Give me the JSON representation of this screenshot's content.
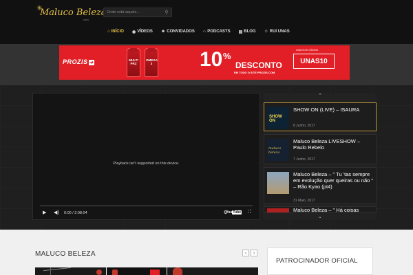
{
  "header": {
    "logo_text": "Maluco Beleza",
    "logo_sub": ".com",
    "search_placeholder": "Onde está aquele...",
    "nav": [
      {
        "label": "INÍCIO",
        "icon": "home-icon"
      },
      {
        "label": "VÍDEOS",
        "icon": "play-circle-icon"
      },
      {
        "label": "CONVIDADOS",
        "icon": "users-icon"
      },
      {
        "label": "PODCASTS",
        "icon": "headphones-icon"
      },
      {
        "label": "BLOG",
        "icon": "blog-icon"
      },
      {
        "label": "RUI UNAS",
        "icon": "user-icon"
      }
    ]
  },
  "banner": {
    "brand": "PROZIS",
    "bottle1": "MULTI PRZ",
    "bottle2": "OMEGA 3",
    "percent": "10",
    "percent_sign": "%",
    "discount": "DESCONTO",
    "subtext": "EM TODO O SITE PROZIS.COM",
    "code_label": "USA ESTE CÓDIGO",
    "code": "UNAS10"
  },
  "player": {
    "message": "Playback isn't supported on this device.",
    "time": "0:00  /  2:08:04",
    "yt_label": "You",
    "yt_tube": "Tube"
  },
  "playlist": [
    {
      "title": "SHOW ON (LIVE) – ISAURA",
      "date": "8 Junho, 2017",
      "thumb": "SHOW ON"
    },
    {
      "title": "Maluco Beleza LIVESHOW – Paulo Rebelo",
      "date": "7 Junho, 2017",
      "thumb": "maluco beleza"
    },
    {
      "title": "Maluco Beleza – \" Tu 'tas sempre em evolução quer queiras ou não \" – Rão Kyao (pt4)",
      "date": "31 Maio, 2017",
      "thumb": ""
    },
    {
      "title": "Maluco Beleza – \" Há coisas",
      "date": "",
      "thumb": ""
    }
  ],
  "bottom": {
    "section_title": "MALUCO BELEZA",
    "sponsor_title": "PATROCINADOR OFICIAL"
  },
  "colors": {
    "accent": "#e8c34a",
    "banner_red": "#e21f26"
  }
}
